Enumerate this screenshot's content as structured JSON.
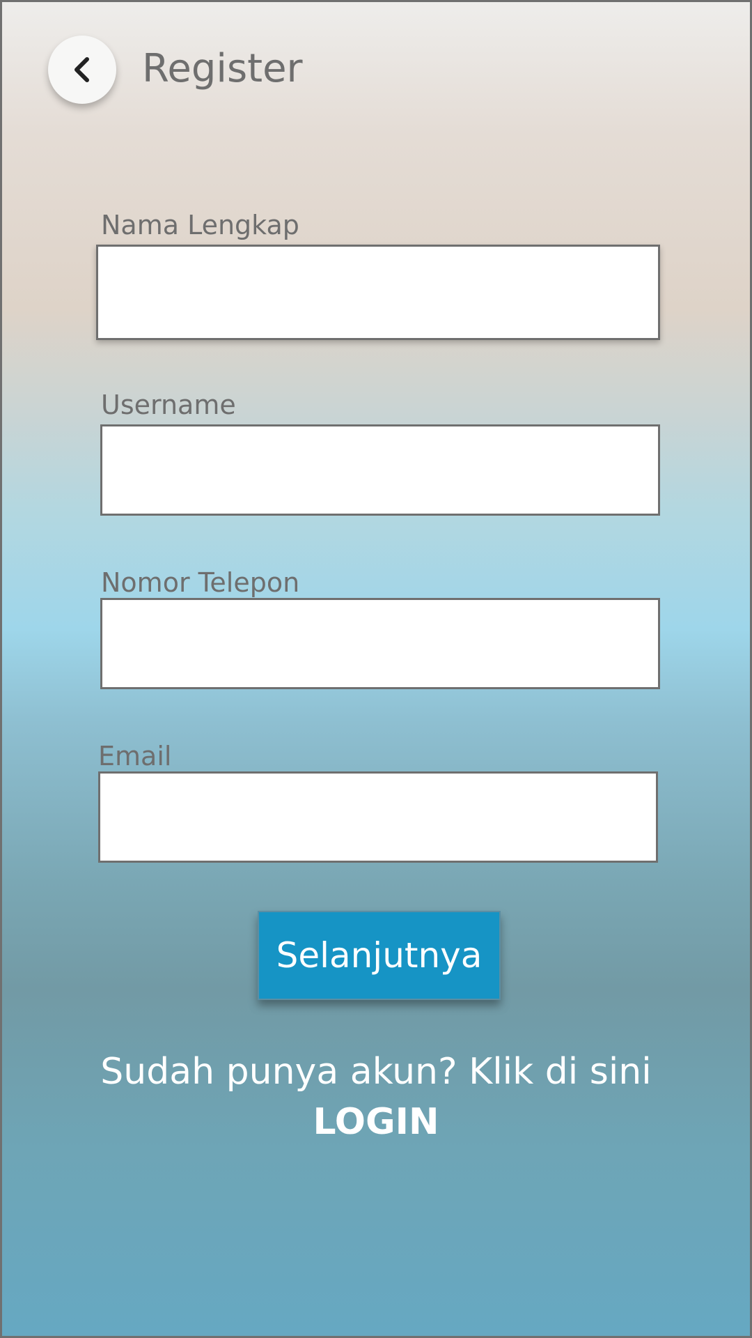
{
  "header": {
    "title": "Register",
    "back_icon": "chevron-left-icon"
  },
  "form": {
    "fields": [
      {
        "label": "Nama Lengkap",
        "value": "",
        "placeholder": ""
      },
      {
        "label": "Username",
        "value": "",
        "placeholder": ""
      },
      {
        "label": "Nomor Telepon",
        "value": "",
        "placeholder": ""
      },
      {
        "label": "Email",
        "value": "",
        "placeholder": ""
      }
    ],
    "submit_label": "Selanjutnya"
  },
  "footer": {
    "prompt": "Sudah punya akun? Klik di sini",
    "login_label": "LOGIN"
  },
  "colors": {
    "button_bg": "#1694c5",
    "label_text": "#6e6e6e",
    "input_border": "#6f6f6f"
  }
}
